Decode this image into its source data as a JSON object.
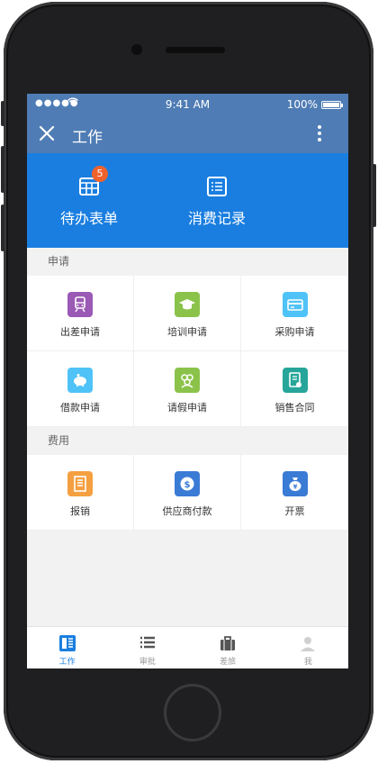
{
  "status_bar": {
    "time": "9:41 AM",
    "battery": "100%"
  },
  "nav": {
    "title": "工作"
  },
  "hero": {
    "items": [
      {
        "label": "待办表单",
        "badge": "5",
        "icon": "todo-form-icon"
      },
      {
        "label": "消费记录",
        "icon": "records-list-icon"
      }
    ]
  },
  "sections": [
    {
      "title": "申请",
      "items": [
        {
          "label": "出差申请",
          "icon": "train-icon",
          "color": "#9b59b6"
        },
        {
          "label": "培训申请",
          "icon": "graduation-cap-icon",
          "color": "#8bc34a"
        },
        {
          "label": "采购申请",
          "icon": "card-icon",
          "color": "#4fc3f7"
        },
        {
          "label": "借款申请",
          "icon": "piggy-bank-icon",
          "color": "#4fc3f7"
        },
        {
          "label": "请假申请",
          "icon": "people-icon",
          "color": "#8bc34a"
        },
        {
          "label": "销售合同",
          "icon": "contract-icon",
          "color": "#26a69a"
        }
      ]
    },
    {
      "title": "费用",
      "items": [
        {
          "label": "报销",
          "icon": "receipt-icon",
          "color": "#f5a040"
        },
        {
          "label": "供应商付款",
          "icon": "dollar-coin-icon",
          "color": "#3a7bd5"
        },
        {
          "label": "开票",
          "icon": "money-bag-icon",
          "color": "#3a7bd5"
        }
      ]
    }
  ],
  "tabbar": {
    "items": [
      {
        "label": "工作",
        "active": true
      },
      {
        "label": "审批",
        "active": false
      },
      {
        "label": "差旅",
        "active": false
      },
      {
        "label": "我",
        "active": false
      }
    ]
  },
  "colors": {
    "nav_blue": "#4f7cb4",
    "hero_blue": "#1a7ee0",
    "badge_orange": "#f0622b"
  }
}
